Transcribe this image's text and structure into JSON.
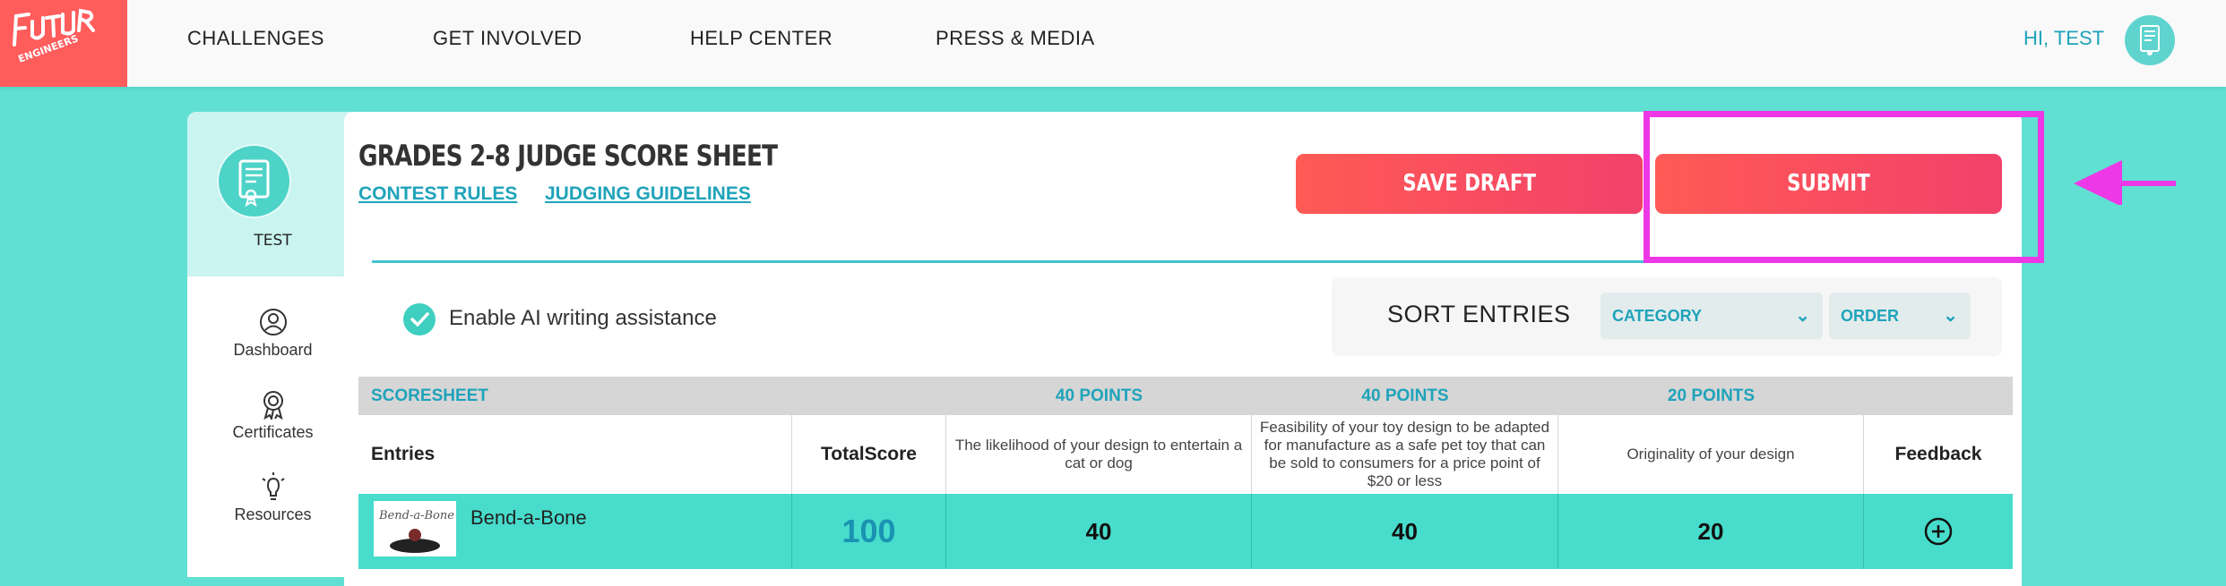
{
  "nav": {
    "links": [
      "CHALLENGES",
      "GET INVOLVED",
      "HELP CENTER",
      "PRESS & MEDIA"
    ],
    "greeting": "HI, TEST"
  },
  "sidebar": {
    "user": "TEST",
    "items": [
      {
        "label": "Dashboard",
        "icon": "user-circle-icon"
      },
      {
        "label": "Certificates",
        "icon": "award-ribbon-icon"
      },
      {
        "label": "Resources",
        "icon": "lightbulb-icon"
      }
    ]
  },
  "sheet": {
    "title": "GRADES 2-8 JUDGE SCORE SHEET",
    "contest_rules": "CONTEST RULES",
    "judging_guidelines": "JUDGING GUIDELINES",
    "save_draft": "SAVE DRAFT",
    "submit": "SUBMIT"
  },
  "ai": {
    "label": "Enable AI writing assistance",
    "checked": true
  },
  "sort": {
    "title": "SORT ENTRIES",
    "category": "CATEGORY",
    "order": "ORDER"
  },
  "table": {
    "scoresheet": "SCORESHEET",
    "points": [
      "40 POINTS",
      "40 POINTS",
      "20 POINTS"
    ],
    "columns": {
      "entries": "Entries",
      "total": "TotalScore",
      "c1": "The likelihood of your design to entertain a cat or dog",
      "c2": "Feasibility of your toy design to be adapted for manufacture as a safe pet toy that can be sold to consumers for a price point of $20 or less",
      "c3": "Originality of your design",
      "feedback": "Feedback"
    },
    "rows": [
      {
        "name": "Bend-a-Bone",
        "total": "100",
        "s1": "40",
        "s2": "40",
        "s3": "20"
      }
    ]
  },
  "colors": {
    "accent": "#1fa3ba",
    "teal": "#5fe0d2",
    "button": "#ff5a55",
    "annotation": "#ee37e7"
  }
}
